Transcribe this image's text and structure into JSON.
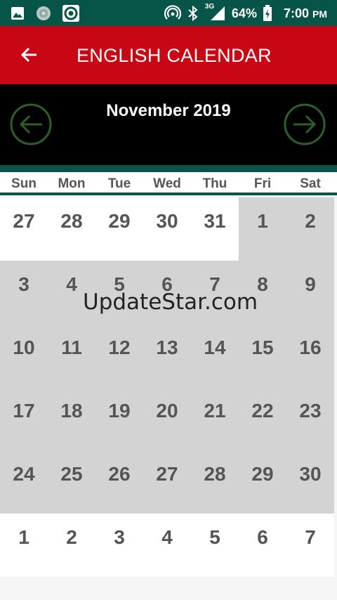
{
  "status_bar": {
    "battery": "64%",
    "time": "7:00",
    "ampm": "PM",
    "network": "3G",
    "icons": [
      "image-icon",
      "media-icon",
      "target-icon",
      "hotspot-icon",
      "bluetooth-icon",
      "signal-icon",
      "battery-icon"
    ]
  },
  "app_bar": {
    "title": "ENGLISH CALENDAR",
    "back_icon": "arrow-left-icon"
  },
  "month_header": {
    "title": "November 2019",
    "prev_icon": "circle-arrow-left-icon",
    "next_icon": "circle-arrow-right-icon",
    "nav_color": "#2e5e2a"
  },
  "weekdays": [
    "Sun",
    "Mon",
    "Tue",
    "Wed",
    "Thu",
    "Fri",
    "Sat"
  ],
  "days": [
    {
      "d": "27",
      "in": false
    },
    {
      "d": "28",
      "in": false
    },
    {
      "d": "29",
      "in": false
    },
    {
      "d": "30",
      "in": false
    },
    {
      "d": "31",
      "in": false
    },
    {
      "d": "1",
      "in": true
    },
    {
      "d": "2",
      "in": true
    },
    {
      "d": "3",
      "in": true
    },
    {
      "d": "4",
      "in": true
    },
    {
      "d": "5",
      "in": true
    },
    {
      "d": "6",
      "in": true
    },
    {
      "d": "7",
      "in": true
    },
    {
      "d": "8",
      "in": true
    },
    {
      "d": "9",
      "in": true
    },
    {
      "d": "10",
      "in": true
    },
    {
      "d": "11",
      "in": true
    },
    {
      "d": "12",
      "in": true
    },
    {
      "d": "13",
      "in": true
    },
    {
      "d": "14",
      "in": true
    },
    {
      "d": "15",
      "in": true
    },
    {
      "d": "16",
      "in": true
    },
    {
      "d": "17",
      "in": true
    },
    {
      "d": "18",
      "in": true
    },
    {
      "d": "19",
      "in": true
    },
    {
      "d": "20",
      "in": true
    },
    {
      "d": "21",
      "in": true
    },
    {
      "d": "22",
      "in": true
    },
    {
      "d": "23",
      "in": true
    },
    {
      "d": "24",
      "in": true
    },
    {
      "d": "25",
      "in": true
    },
    {
      "d": "26",
      "in": true
    },
    {
      "d": "27",
      "in": true
    },
    {
      "d": "28",
      "in": true
    },
    {
      "d": "29",
      "in": true
    },
    {
      "d": "30",
      "in": true
    },
    {
      "d": "1",
      "in": false
    },
    {
      "d": "2",
      "in": false
    },
    {
      "d": "3",
      "in": false
    },
    {
      "d": "4",
      "in": false
    },
    {
      "d": "5",
      "in": false
    },
    {
      "d": "6",
      "in": false
    },
    {
      "d": "7",
      "in": false
    }
  ],
  "watermark": "UpdateStar.com",
  "colors": {
    "status_bar": "#075549",
    "app_bar": "#c90613",
    "month_bar": "#000000",
    "in_month": "#d3d3d3",
    "out_month": "#ffffff",
    "day_text": "#555555"
  }
}
